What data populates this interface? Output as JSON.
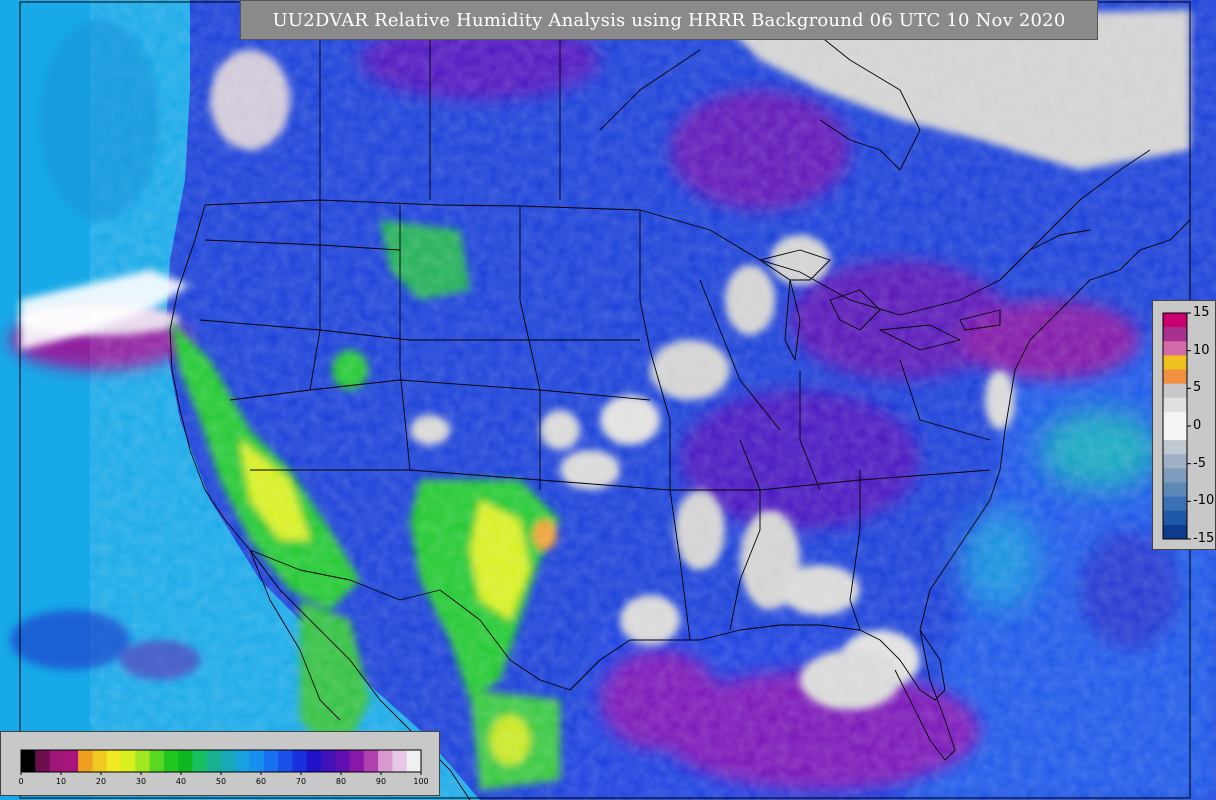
{
  "title": "UU2DVAR Relative Humidity Analysis using HRRR Background 06 UTC 10 Nov 2020",
  "colors": {
    "ocean_cyan": "#18a9e8",
    "ocean_blue": "#1a4ee0",
    "deep_blue": "#1010c8",
    "purple": "#7a18b8",
    "magenta": "#a01a8c",
    "light_grey": "#d2d2d2",
    "white": "#f4f4f4",
    "green": "#20c830",
    "yellow": "#f0f020",
    "orange": "#f0a030",
    "border": "#000000"
  },
  "side_legend": {
    "ticks": [
      "15",
      "10",
      "5",
      "0",
      "-5",
      "-10",
      "-15"
    ],
    "bands": [
      "#c8006e",
      "#a8308e",
      "#d46aa8",
      "#f0c020",
      "#f09040",
      "#c8c8c8",
      "#e0e0e0",
      "#f4f4f4",
      "#f4f4f4",
      "#c0c8d0",
      "#a0b0c4",
      "#7e9cbc",
      "#5e88b8",
      "#3c70b4",
      "#2058a8",
      "#0c3c8c"
    ]
  },
  "bottom_legend": {
    "ticks": [
      "0",
      "10",
      "20",
      "30",
      "40",
      "50",
      "60",
      "70",
      "80",
      "90",
      "100"
    ],
    "bands": [
      "#000000",
      "#6e0e4e",
      "#9e1678",
      "#a8147c",
      "#f0a020",
      "#f0c820",
      "#f0e820",
      "#d8f020",
      "#a0e820",
      "#58d820",
      "#20c820",
      "#10b820",
      "#18c060",
      "#18b090",
      "#18a8b8",
      "#18a0e0",
      "#1890f0",
      "#1870f0",
      "#1850e8",
      "#1830e0",
      "#2010c8",
      "#4010b8",
      "#6010b0",
      "#8818a8",
      "#b040b0",
      "#d898d0",
      "#e8c8e8",
      "#f0f0f0"
    ]
  }
}
